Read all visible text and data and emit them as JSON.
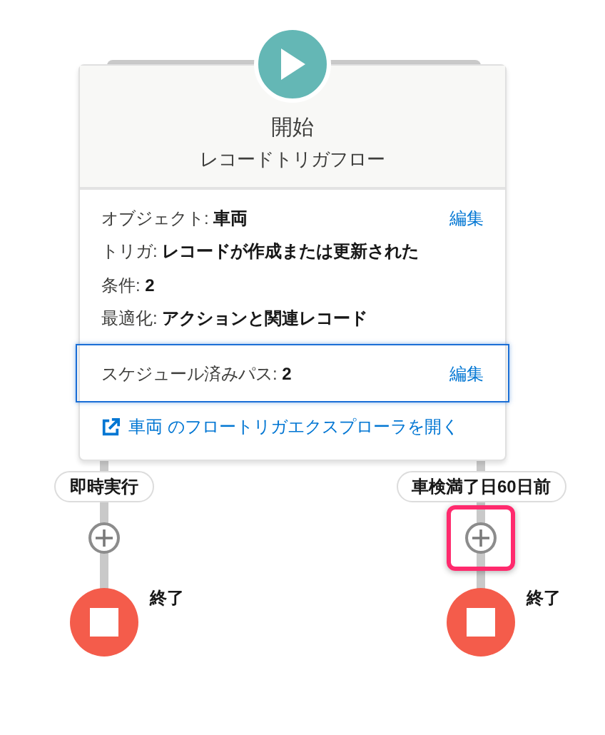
{
  "start": {
    "title": "開始",
    "subtitle": "レコードトリガフロー"
  },
  "details": [
    {
      "label": "オブジェクト:",
      "value": "車両",
      "action": "編集"
    },
    {
      "label": "トリガ:",
      "value": "レコードが作成または更新された"
    },
    {
      "label": "条件:",
      "value": "2"
    },
    {
      "label": "最適化:",
      "value": "アクションと関連レコード"
    }
  ],
  "scheduled_paths": {
    "label": "スケジュール済みパス:",
    "value": "2",
    "action": "編集",
    "selected": true
  },
  "explorer_link": "車両 のフロートリガエクスプローラを開く",
  "branches": [
    {
      "label": "即時実行",
      "add_highlighted": false,
      "end_label": "終了"
    },
    {
      "label": "車検満了日60日前",
      "add_highlighted": true,
      "end_label": "終了"
    }
  ]
}
